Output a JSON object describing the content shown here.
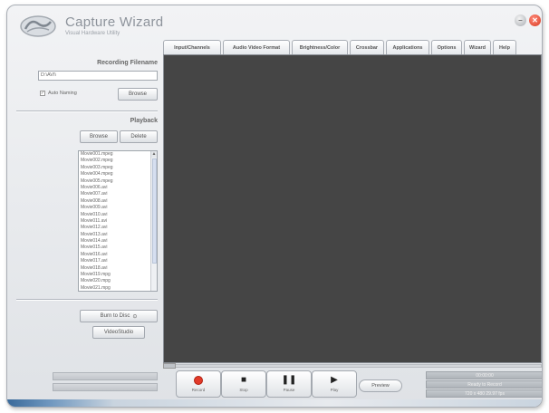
{
  "app": {
    "title": "Capture Wizard",
    "subtitle": "Visual Hardware Utility",
    "minimize_glyph": "–",
    "close_glyph": "✕"
  },
  "tabs": [
    {
      "label": "Input/Channels"
    },
    {
      "label": "Audio Video Format"
    },
    {
      "label": "Brightness/Color"
    },
    {
      "label": "Crossbar"
    },
    {
      "label": "Applications"
    },
    {
      "label": "Options"
    },
    {
      "label": "Wizard"
    },
    {
      "label": "Help"
    }
  ],
  "recording": {
    "title": "Recording Filename",
    "filename_value": "D:\\AVI\\",
    "auto_naming_label": "Auto Naming",
    "auto_naming_checked": "✓",
    "browse_button": "Browse"
  },
  "playback": {
    "title": "Playback",
    "browse_button": "Browse",
    "delete_button": "Delete",
    "files": [
      "Movie001.mpeg",
      "Movie002.mpeg",
      "Movie003.mpeg",
      "Movie004.mpeg",
      "Movie005.mpeg",
      "Movie006.avi",
      "Movie007.avi",
      "Movie008.avi",
      "Movie009.avi",
      "Movie010.avi",
      "Movie011.avi",
      "Movie012.avi",
      "Movie013.avi",
      "Movie014.avi",
      "Movie015.avi",
      "Movie016.avi",
      "Movie017.avi",
      "Movie018.avi",
      "Movie019.mpg",
      "Movie020.mpg",
      "Movie021.mpg"
    ]
  },
  "bottom_left": {
    "burn_button": "Burn to Disc",
    "video_studio_button": "VideoStudio"
  },
  "controls": {
    "record": "Record",
    "stop": "Stop",
    "pause": "Pause",
    "play": "Play",
    "preview": "Preview"
  },
  "status": {
    "right_1": "00:00:00",
    "right_2": "Ready to Record",
    "right_3": "720 x 480 29.97 fps"
  }
}
